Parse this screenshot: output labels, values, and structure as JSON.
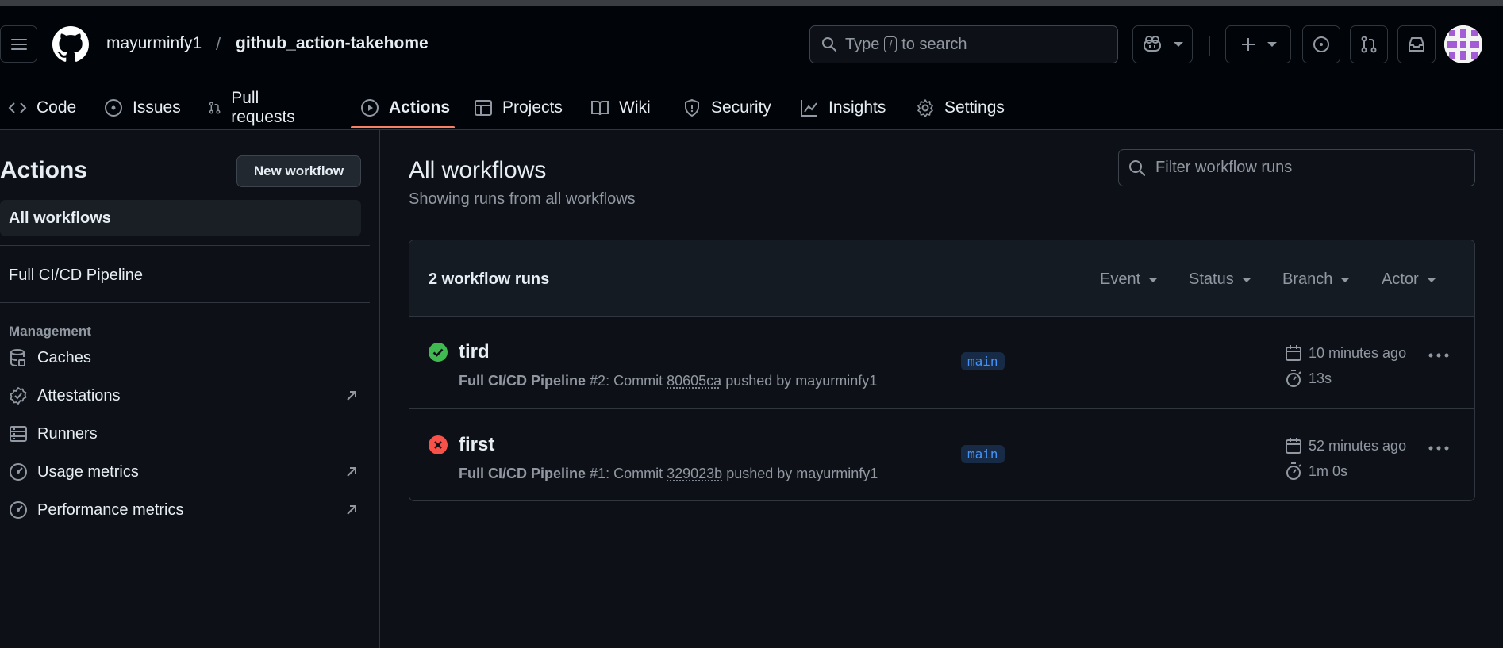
{
  "header": {
    "owner": "mayurminfy1",
    "separator": "/",
    "repo": "github_action-takehome",
    "search": {
      "prefix": "Type",
      "key": "/",
      "suffix": "to search"
    }
  },
  "tabs": [
    {
      "label": "Code",
      "icon": "code-icon"
    },
    {
      "label": "Issues",
      "icon": "issue-icon"
    },
    {
      "label": "Pull requests",
      "icon": "pull-request-icon"
    },
    {
      "label": "Actions",
      "icon": "play-icon",
      "active": true
    },
    {
      "label": "Projects",
      "icon": "table-icon"
    },
    {
      "label": "Wiki",
      "icon": "book-icon"
    },
    {
      "label": "Security",
      "icon": "shield-icon"
    },
    {
      "label": "Insights",
      "icon": "graph-icon"
    },
    {
      "label": "Settings",
      "icon": "gear-icon"
    }
  ],
  "sidebar": {
    "title": "Actions",
    "new_workflow": "New workflow",
    "all_workflows": "All workflows",
    "workflows": [
      "Full CI/CD Pipeline"
    ],
    "management_heading": "Management",
    "management": [
      {
        "label": "Caches",
        "icon": "database-icon"
      },
      {
        "label": "Attestations",
        "icon": "verified-icon",
        "external": true
      },
      {
        "label": "Runners",
        "icon": "server-icon"
      },
      {
        "label": "Usage metrics",
        "icon": "meter-icon",
        "external": true
      },
      {
        "label": "Performance metrics",
        "icon": "meter-icon",
        "external": true
      }
    ]
  },
  "main": {
    "title": "All workflows",
    "subtitle": "Showing runs from all workflows",
    "filter_placeholder": "Filter workflow runs",
    "count": "2 workflow runs",
    "filters": [
      "Event",
      "Status",
      "Branch",
      "Actor"
    ],
    "runs": [
      {
        "title": "tird",
        "status": "success",
        "workflow": "Full CI/CD Pipeline",
        "number": "#2",
        "commit_label": "Commit",
        "sha": "80605ca",
        "pushed_by": "pushed by mayurminfy1",
        "branch": "main",
        "time": "10 minutes ago",
        "duration": "13s"
      },
      {
        "title": "first",
        "status": "failure",
        "workflow": "Full CI/CD Pipeline",
        "number": "#1",
        "commit_label": "Commit",
        "sha": "329023b",
        "pushed_by": "pushed by mayurminfy1",
        "branch": "main",
        "time": "52 minutes ago",
        "duration": "1m 0s"
      }
    ]
  },
  "colors": {
    "bg": "#0d1117",
    "header_bg": "#010409",
    "accent_underline": "#f78166",
    "success": "#3fb950",
    "failure": "#f85149",
    "branch_text": "#4493f8"
  }
}
